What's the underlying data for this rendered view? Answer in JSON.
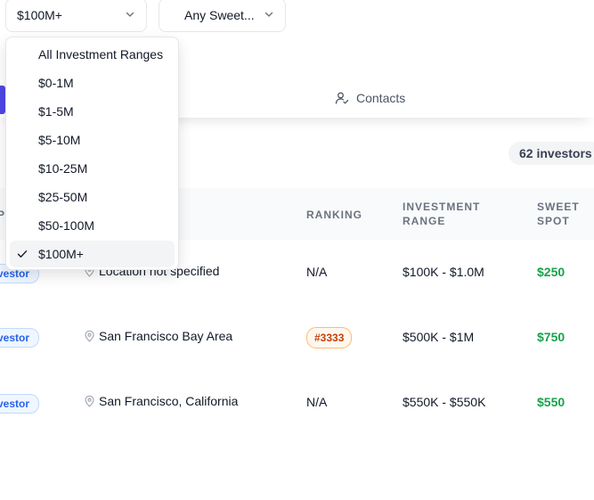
{
  "filters": {
    "investment_range": {
      "selected": "$100M+"
    },
    "sweet_spot": {
      "selected": "Any Sweet..."
    }
  },
  "dropdown": {
    "options": [
      {
        "label": "All Investment Ranges",
        "selected": false
      },
      {
        "label": "$0-1M",
        "selected": false
      },
      {
        "label": "$1-5M",
        "selected": false
      },
      {
        "label": "$5-10M",
        "selected": false
      },
      {
        "label": "$10-25M",
        "selected": false
      },
      {
        "label": "$25-50M",
        "selected": false
      },
      {
        "label": "$50-100M",
        "selected": false
      },
      {
        "label": "$100M+",
        "selected": true
      }
    ]
  },
  "tabs": {
    "contacts": {
      "label": "Contacts",
      "icon": "user-check-icon"
    }
  },
  "summary": {
    "count_label": "62 investors"
  },
  "table": {
    "columns": {
      "ranking": "RANKING",
      "investment_range": [
        "INVESTMENT",
        "RANGE"
      ],
      "sweet_spot": [
        "SWEET",
        "SPOT"
      ],
      "first_col_fragment": "P"
    },
    "rows": [
      {
        "type_badge": "vestor",
        "location": "Location not specified",
        "ranking": "N/A",
        "ranking_is_badge": false,
        "range": "$100K - $1.0M",
        "sweet_spot": "$250"
      },
      {
        "type_badge": "vestor",
        "location": "San Francisco Bay Area",
        "ranking": "#3333",
        "ranking_is_badge": true,
        "range": "$500K - $1M",
        "sweet_spot": "$750"
      },
      {
        "type_badge": "vestor",
        "location": "San Francisco, California",
        "ranking": "N/A",
        "ranking_is_badge": false,
        "range": "$550K - $550K",
        "sweet_spot": "$550"
      }
    ]
  },
  "colors": {
    "accent": "#4f46e5",
    "sweet_spot_green": "#16a34a",
    "rank_badge_orange": "#c2410c",
    "investor_badge_blue": "#2563eb"
  }
}
